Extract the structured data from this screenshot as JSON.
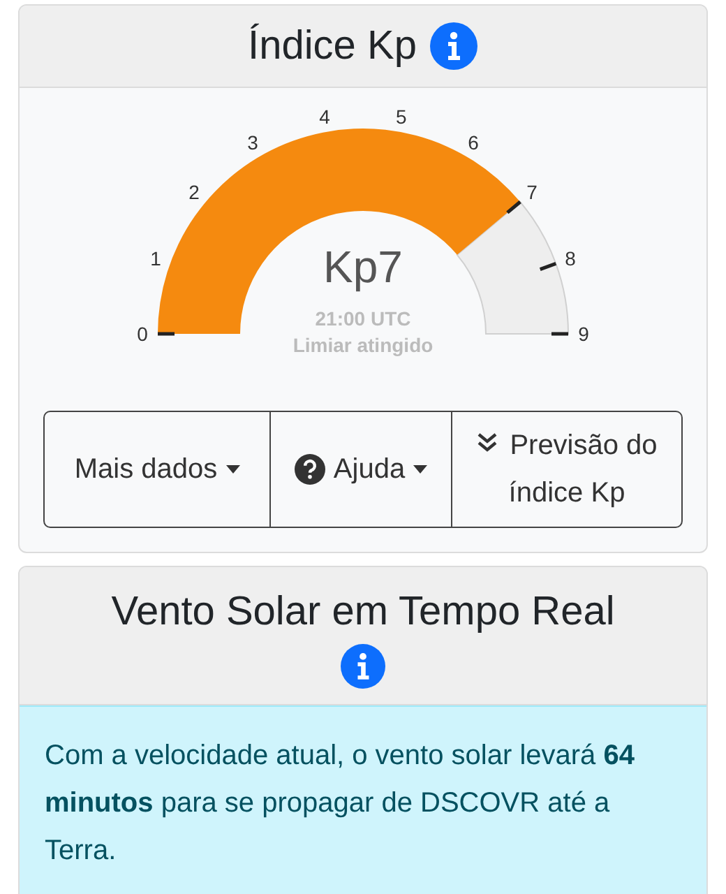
{
  "kp_card": {
    "title": "Índice Kp",
    "gauge": {
      "scale": [
        "0",
        "1",
        "2",
        "3",
        "4",
        "5",
        "6",
        "7",
        "8",
        "9"
      ],
      "value": "Kp7",
      "time": "21:00 UTC",
      "status": "Limiar atingido"
    },
    "buttons": [
      {
        "kind": "dropdown",
        "label": "Mais dados"
      },
      {
        "kind": "help-dropdown",
        "label": "Ajuda"
      },
      {
        "kind": "link",
        "label": "Previsão do índice Kp"
      }
    ]
  },
  "wind_card": {
    "title": "Vento Solar em Tempo Real",
    "alert": "Com a velocidade atual, o vento solar levará **64 minutos** para se propagar de DSCOVR até a Terra."
  }
}
